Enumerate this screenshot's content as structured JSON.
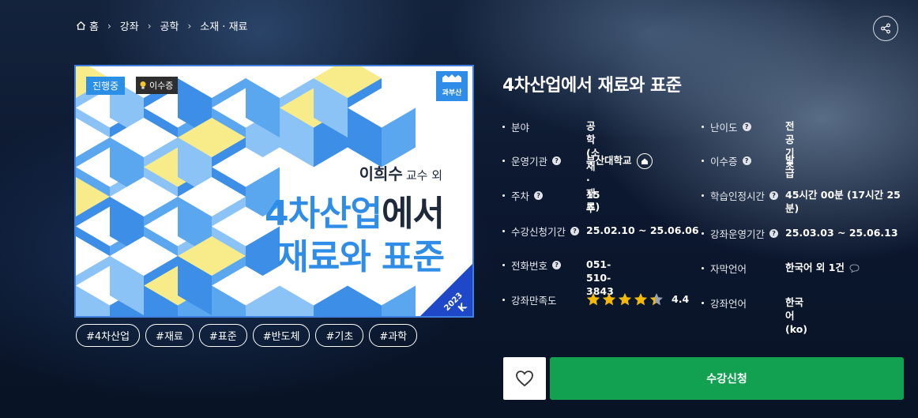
{
  "breadcrumb": {
    "home": "홈",
    "items": [
      "강좌",
      "공학",
      "소재 · 재료"
    ]
  },
  "course": {
    "title": "4차산업에서 재료와 표준",
    "badges": {
      "status": "진행중",
      "certificate": "이수증"
    },
    "thumbnail": {
      "logo_text": "과부산",
      "professor": "이희수",
      "professor_suffix": "교수 외",
      "title_line1_highlight": "4차산업",
      "title_line1_rest": "에서",
      "title_line2": "재료와 표준",
      "corner_year": "2023",
      "corner_mark": "K"
    },
    "tags": [
      "#4차산업",
      "#재료",
      "#표준",
      "#반도체",
      "#기초",
      "#과학"
    ]
  },
  "info": {
    "field": {
      "label": "분야",
      "value": "공학 (소재 · 재료)"
    },
    "difficulty": {
      "label": "난이도",
      "value": "전공기초"
    },
    "institution": {
      "label": "운영기관",
      "value": "부산대학교"
    },
    "certificate": {
      "label": "이수증",
      "value": "발급"
    },
    "weeks": {
      "label": "주차",
      "value": "15 주"
    },
    "study_time": {
      "label": "학습인정시간",
      "value": "45시간 00분 (17시간 25분)"
    },
    "enroll_period": {
      "label": "수강신청기간",
      "value": "25.02.10 ~ 25.06.06"
    },
    "course_period": {
      "label": "강좌운영기간",
      "value": "25.03.03 ~ 25.06.13"
    },
    "phone": {
      "label": "전화번호",
      "value": "051-510-3843"
    },
    "subtitle_lang": {
      "label": "자막언어",
      "value": "한국어 외 1건"
    },
    "satisfaction": {
      "label": "강좌만족도",
      "value": "4.4",
      "rating": 4.4
    },
    "course_lang": {
      "label": "강좌언어",
      "value": "한국어(ko)"
    }
  },
  "actions": {
    "apply": "수강신청"
  },
  "colors": {
    "apply": "#12a150",
    "star": "#f5b800",
    "brand_blue": "#2f8de8"
  }
}
